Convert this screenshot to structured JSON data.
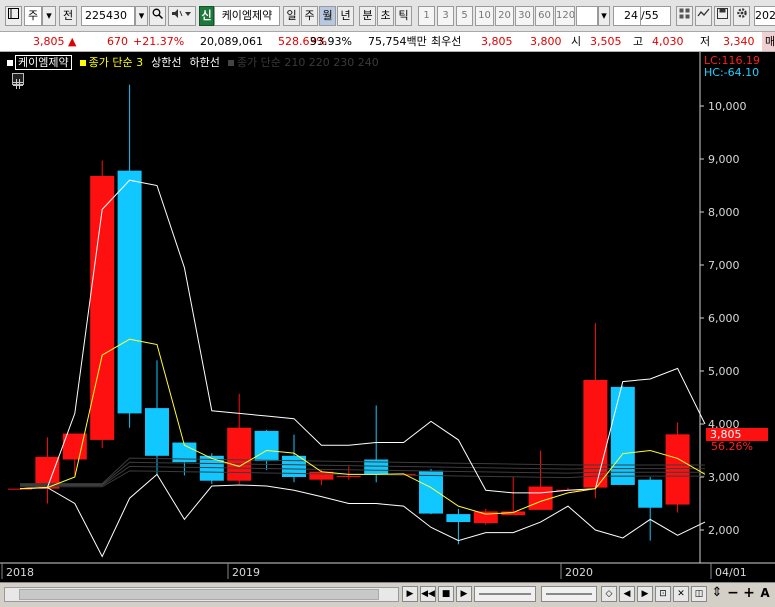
{
  "toolbar": {
    "period_code": "주",
    "prev_label": "전",
    "stock_code": "225430",
    "credit_badge": "신",
    "stock_name": "케이엠제약",
    "period_tabs": [
      "일",
      "주",
      "월",
      "년"
    ],
    "time_tabs": [
      "분",
      "초",
      "틱"
    ],
    "interval_buttons": [
      "1",
      "3",
      "5",
      "10",
      "20",
      "30",
      "60",
      "120"
    ],
    "count_value": "24",
    "count_total": "/55",
    "cut_label": "202"
  },
  "quote": {
    "price": "3,805",
    "change_arrow": "▲",
    "change": "670",
    "change_pct": "+21.37%",
    "volume": "20,089,061",
    "volume_ratio": "528.63%",
    "vol_extra": "93.93%",
    "amount": "75,754백만",
    "priority_label": "최우선",
    "priority_ask": "3,805",
    "priority_bid": "3,800",
    "open_label": "시",
    "open": "3,505",
    "high_label": "고",
    "high": "4,030",
    "low_label": "저",
    "low": "3,340",
    "trade_label": "매"
  },
  "chart_legend": {
    "name": "케이엠제약",
    "line1": "종가 단순 3",
    "line2": "상한선",
    "line3": "하한선",
    "line4": "종가 단순 210 220 230 240",
    "lc": "LC:116.19",
    "hc": "HC:-64.10",
    "price_tag": "3,805",
    "pct_tag": "56.26%"
  },
  "colors": {
    "up": "#ff1010",
    "down": "#10c8ff",
    "ma": "#ffff33",
    "band": "#ffffff",
    "long_ma": "#3c3c3c"
  },
  "chart_data": {
    "type": "candlestick",
    "y_ticks": [
      "2,000",
      "3,000",
      "4,000",
      "5,000",
      "6,000",
      "7,000",
      "8,000",
      "9,000",
      "10,000"
    ],
    "ylim": [
      1400,
      10900
    ],
    "x_labels": [
      "2018",
      "2019",
      "2020",
      "04/01"
    ],
    "candles": [
      {
        "o": 2780,
        "h": 2780,
        "l": 2780,
        "c": 2780
      },
      {
        "o": 2780,
        "h": 3750,
        "l": 2500,
        "c": 3380
      },
      {
        "o": 3330,
        "h": 3800,
        "l": 3030,
        "c": 3820
      },
      {
        "o": 3700,
        "h": 8970,
        "l": 3550,
        "c": 8680
      },
      {
        "o": 8780,
        "h": 10400,
        "l": 3930,
        "c": 4200
      },
      {
        "o": 4300,
        "h": 5200,
        "l": 3050,
        "c": 3400
      },
      {
        "o": 3650,
        "h": 3650,
        "l": 3030,
        "c": 3280
      },
      {
        "o": 3400,
        "h": 3450,
        "l": 2870,
        "c": 2930
      },
      {
        "o": 2930,
        "h": 4570,
        "l": 2870,
        "c": 3930
      },
      {
        "o": 3870,
        "h": 3890,
        "l": 3130,
        "c": 3300
      },
      {
        "o": 3400,
        "h": 3800,
        "l": 2900,
        "c": 3000
      },
      {
        "o": 2950,
        "h": 3150,
        "l": 2850,
        "c": 3100
      },
      {
        "o": 3000,
        "h": 3200,
        "l": 2950,
        "c": 3020
      },
      {
        "o": 3330,
        "h": 4350,
        "l": 2900,
        "c": 3050
      },
      {
        "o": 3050,
        "h": 3070,
        "l": 3060,
        "c": 3060
      },
      {
        "o": 3120,
        "h": 3150,
        "l": 2300,
        "c": 2310
      },
      {
        "o": 2300,
        "h": 2400,
        "l": 1730,
        "c": 2150
      },
      {
        "o": 2130,
        "h": 2400,
        "l": 2100,
        "c": 2350
      },
      {
        "o": 2280,
        "h": 3000,
        "l": 2290,
        "c": 2350
      },
      {
        "o": 2380,
        "h": 3500,
        "l": 2390,
        "c": 2820
      },
      {
        "o": 2750,
        "h": 2800,
        "l": 2750,
        "c": 2760
      },
      {
        "o": 2800,
        "h": 5900,
        "l": 2600,
        "c": 4830
      },
      {
        "o": 4700,
        "h": 4720,
        "l": 2850,
        "c": 2850
      },
      {
        "o": 2950,
        "h": 3000,
        "l": 1800,
        "c": 2420
      },
      {
        "o": 2480,
        "h": 4030,
        "l": 2330,
        "c": 3805
      }
    ],
    "ma3": [
      2780,
      2800,
      3000,
      5300,
      5600,
      5500,
      3600,
      3350,
      3200,
      3500,
      3450,
      3100,
      3050,
      3050,
      3060,
      2800,
      2450,
      2300,
      2330,
      2540,
      2700,
      2780,
      3440,
      3500,
      3350,
      3050
    ],
    "band_upper": [
      2780,
      2800,
      4200,
      8050,
      8600,
      8500,
      6950,
      4250,
      4200,
      4150,
      4100,
      3600,
      3600,
      3650,
      3650,
      4050,
      3700,
      2750,
      2700,
      2700,
      2750,
      2780,
      4800,
      4850,
      5050,
      4000
    ],
    "band_lower": [
      2780,
      2800,
      2500,
      1500,
      2600,
      3050,
      2200,
      2830,
      2850,
      2830,
      2750,
      2630,
      2500,
      2500,
      2450,
      2050,
      1800,
      1950,
      1950,
      2150,
      2450,
      2000,
      1850,
      2200,
      1900,
      2150
    ]
  }
}
